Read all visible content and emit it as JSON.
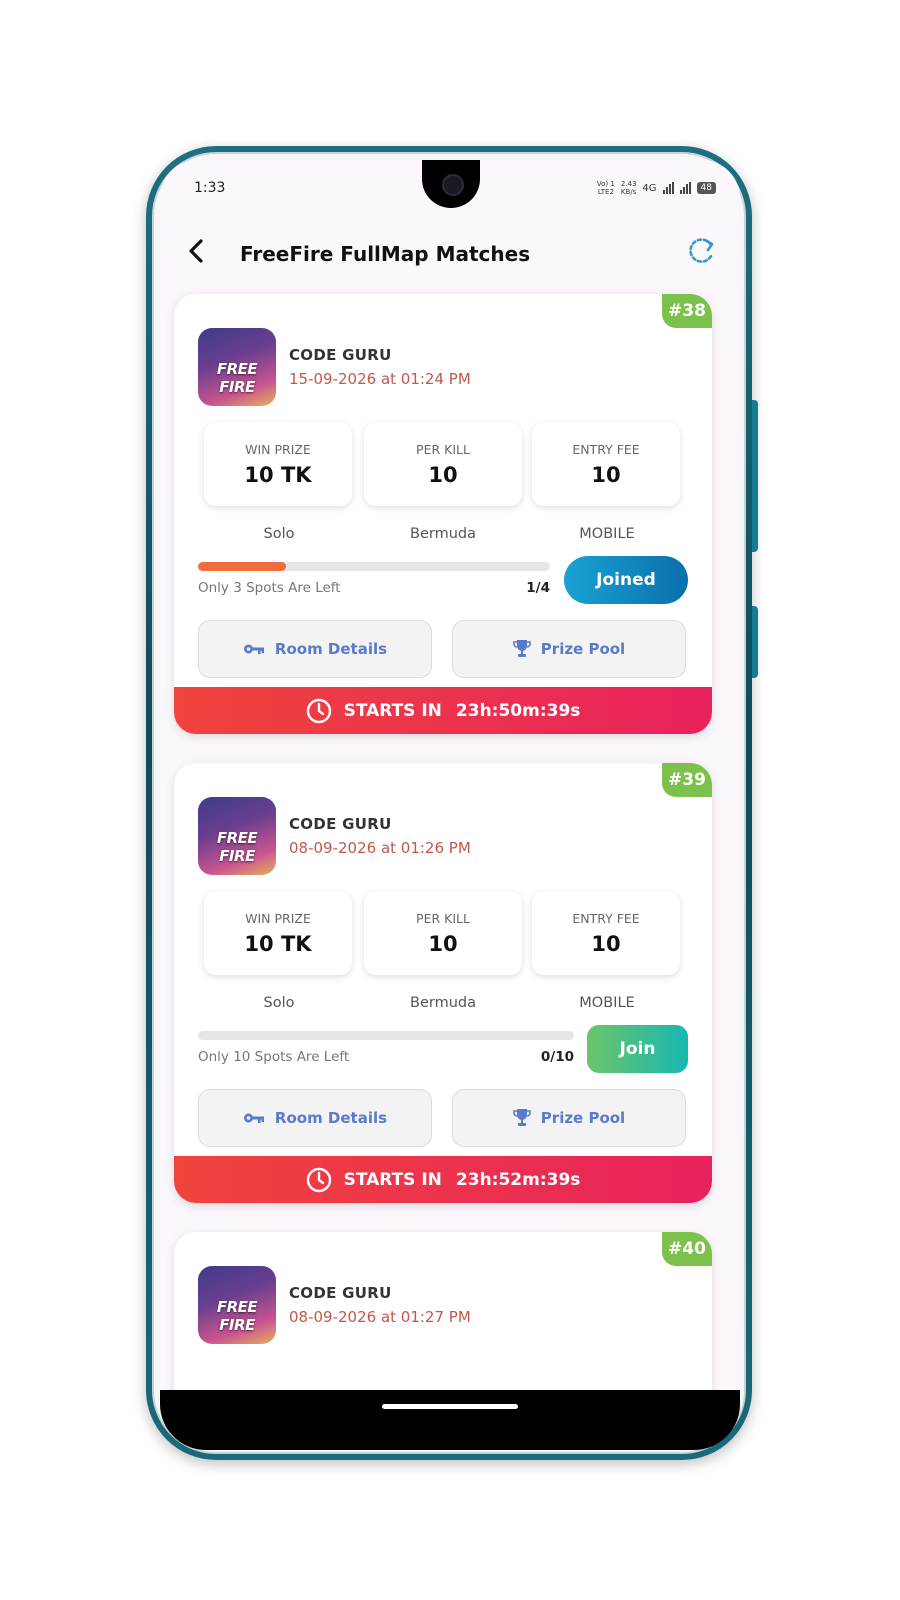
{
  "status_bar": {
    "time": "1:33",
    "net_speed": "2.43\nKB/s",
    "net_speed_top": "2.43",
    "net_speed_bottom": "KB/s",
    "volte_top": "Vo) 1",
    "volte_bottom": "LTE2",
    "network_type": "4G",
    "battery": "48"
  },
  "header": {
    "title": "FreeFire FullMap Matches"
  },
  "labels": {
    "win_prize": "WIN PRIZE",
    "per_kill": "PER KILL",
    "entry_fee": "ENTRY FEE",
    "room_details": "Room Details",
    "prize_pool": "Prize Pool",
    "starts_in": "STARTS IN",
    "thumb_text": "FREE FIRE"
  },
  "matches": [
    {
      "id": "#38",
      "host": "CODE GURU",
      "date": "15-09-2026 at 01:24 PM",
      "win_prize": "10 TK",
      "per_kill": "10",
      "entry_fee": "10",
      "mode": "Solo",
      "map": "Bermuda",
      "platform": "MOBILE",
      "spots_text": "Only 3 Spots Are Left",
      "count": "1/4",
      "progress_fraction": 0.25,
      "button_label": "Joined",
      "countdown": "23h:50m:39s"
    },
    {
      "id": "#39",
      "host": "CODE GURU",
      "date": "08-09-2026 at 01:26 PM",
      "win_prize": "10 TK",
      "per_kill": "10",
      "entry_fee": "10",
      "mode": "Solo",
      "map": "Bermuda",
      "platform": "MOBILE",
      "spots_text": "Only 10 Spots Are Left",
      "count": "0/10",
      "progress_fraction": 0,
      "button_label": "Join",
      "countdown": "23h:52m:39s"
    },
    {
      "id": "#40",
      "host": "CODE GURU",
      "date": "08-09-2026 at 01:27 PM"
    }
  ],
  "colors": {
    "badge": "#7cc14b",
    "date": "#c0594c",
    "timer_start": "#f0443c",
    "timer_end": "#e8225d",
    "joined_start": "#1aa2d3",
    "joined_end": "#0a6fae",
    "join_start": "#6cc56a",
    "join_end": "#17b7b1",
    "action_text": "#5a7acb",
    "progress": "#f26b3a"
  },
  "icons": {
    "back": "back-arrow-icon",
    "refresh": "refresh-icon",
    "room": "key-icon",
    "prize": "trophy-icon",
    "timer": "clock-icon"
  }
}
